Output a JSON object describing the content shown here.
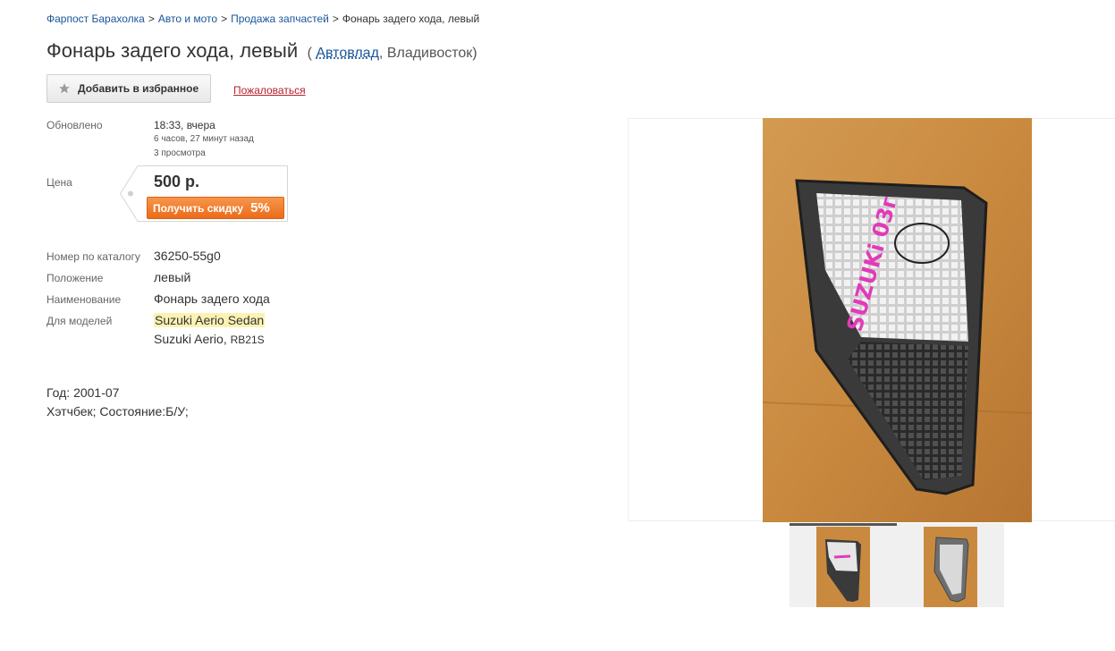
{
  "breadcrumb": {
    "items": [
      "Фарпост Барахолка",
      "Авто и мото",
      "Продажа запчастей"
    ],
    "current": "Фонарь задего хода, левый",
    "separator": ">"
  },
  "header": {
    "title": "Фонарь задего хода, левый",
    "open_paren": "(",
    "seller": "Автовлад",
    "city_suffix": ", Владивосток)"
  },
  "actions": {
    "favorite_label": "Добавить в избранное",
    "complain_label": "Пожаловаться",
    "favorite_icon": "star-icon"
  },
  "updated": {
    "label": "Обновлено",
    "time": "18:33, вчера",
    "ago": "6 часов, 27 минут назад",
    "views": "3 просмотра"
  },
  "price": {
    "label": "Цена",
    "value": "500 р.",
    "discount_label": "Получить скидку",
    "discount_pct": "5%",
    "accent": "#f08030"
  },
  "specs": {
    "catalog_label": "Номер по каталогу",
    "catalog_value": "36250-55g0",
    "position_label": "Положение",
    "position_value": "левый",
    "name_label": "Наименование",
    "name_value": "Фонарь задего хода",
    "models_label": "Для моделей",
    "model_1": "Suzuki Aerio Sedan",
    "model_2": "Suzuki Aerio,",
    "model_2_code": "RB21S"
  },
  "details": {
    "year": "Год: 2001-07",
    "condition": "Хэтчбек; Состояние:Б/У;"
  },
  "gallery": {
    "photo_text": "SUZUKi 03г",
    "thumb_count": 2,
    "active_thumb": 0
  }
}
